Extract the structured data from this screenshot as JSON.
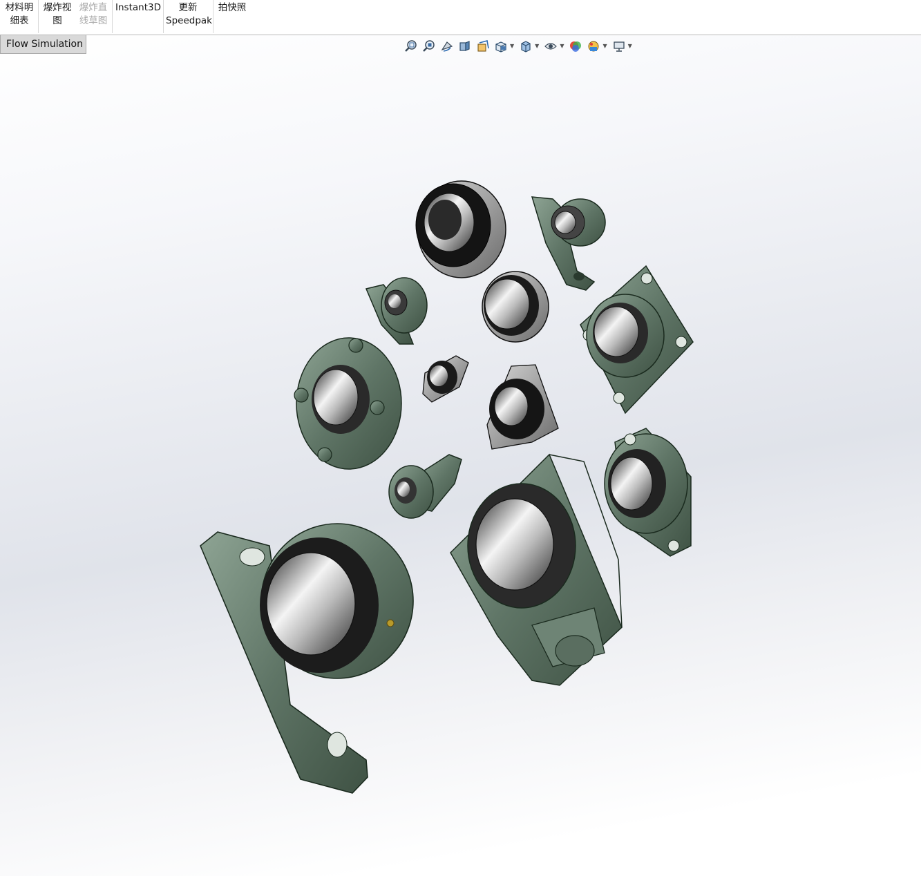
{
  "ribbon": {
    "bom": {
      "line1": "材料明",
      "line2": "细表"
    },
    "explode_view": {
      "line1": "爆炸视",
      "line2": "图"
    },
    "explode_line": {
      "line1": "爆炸直",
      "line2": "线草图"
    },
    "instant3d": "Instant3D",
    "speedpak": {
      "line1": "更新",
      "line2": "Speedpak"
    },
    "snapshot": "拍快照"
  },
  "tabs": {
    "flow_simulation": "Flow Simulation"
  },
  "hud": {
    "icons": [
      "zoom-to-fit-icon",
      "zoom-to-area-icon",
      "previous-view-icon",
      "section-view-icon",
      "dynamic-annotation-icon",
      "view-orientation-icon",
      "display-style-icon",
      "hide-show-items-icon",
      "edit-appearance-icon",
      "apply-scene-icon",
      "view-settings-icon"
    ]
  },
  "colors": {
    "housing": "#5f7566",
    "housing_dark": "#3f5244",
    "housing_light": "#8fa595",
    "bearing_dark": "#1a1a1a",
    "steel_light": "#e8e8e8",
    "steel_dark": "#555555"
  }
}
